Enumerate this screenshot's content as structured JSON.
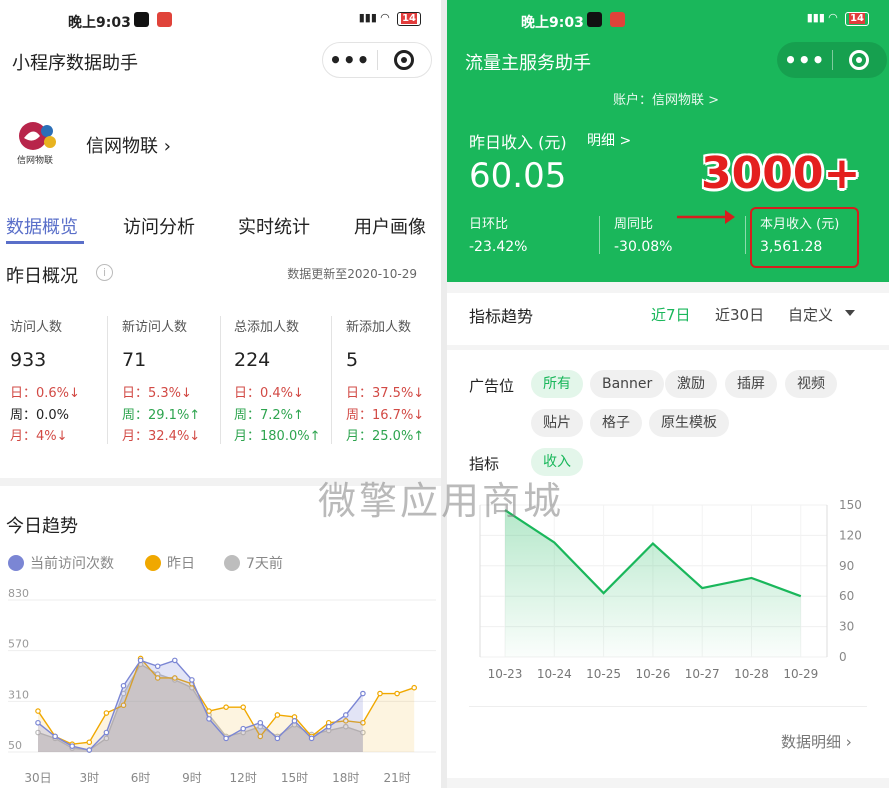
{
  "status": {
    "time": "晚上9:03",
    "battery": "14"
  },
  "left": {
    "title": "小程序数据助手",
    "account": "信网物联",
    "logo_text": "信网物联",
    "tabs": [
      "数据概览",
      "访问分析",
      "实时统计",
      "用户画像"
    ],
    "yday": {
      "title": "昨日概况",
      "updated": "数据更新至2020-10-29",
      "kpis": [
        {
          "label": "访问人数",
          "value": "933",
          "rows": [
            {
              "t": "日：0.6%↓",
              "c": "red"
            },
            {
              "t": "周：0.0%",
              "c": ""
            },
            {
              "t": "月：4%↓",
              "c": "red"
            }
          ]
        },
        {
          "label": "新访问人数",
          "value": "71",
          "rows": [
            {
              "t": "日：5.3%↓",
              "c": "red"
            },
            {
              "t": "周：29.1%↑",
              "c": "green"
            },
            {
              "t": "月：32.4%↓",
              "c": "red"
            }
          ]
        },
        {
          "label": "总添加人数",
          "value": "224",
          "rows": [
            {
              "t": "日：0.4%↓",
              "c": "red"
            },
            {
              "t": "周：7.2%↑",
              "c": "green"
            },
            {
              "t": "月：180.0%↑",
              "c": "green"
            }
          ]
        },
        {
          "label": "新添加人数",
          "value": "5",
          "rows": [
            {
              "t": "日：37.5%↓",
              "c": "red"
            },
            {
              "t": "周：16.7%↓",
              "c": "red"
            },
            {
              "t": "月：25.0%↑",
              "c": "green"
            }
          ]
        }
      ]
    },
    "trend_title": "今日趋势",
    "legend": [
      {
        "name": "当前访问次数",
        "color": "#7b86d4"
      },
      {
        "name": "昨日",
        "color": "#f0a800"
      },
      {
        "name": "7天前",
        "color": "#bdbdbd"
      }
    ]
  },
  "right": {
    "title": "流量主服务助手",
    "account": "账户：信网物联 >",
    "income_label": "昨日收入 (元)",
    "detail": "明细 >",
    "income_value": "60.05",
    "annotation": "3000+",
    "stats": [
      {
        "label": "日环比",
        "value": "-23.42%"
      },
      {
        "label": "周同比",
        "value": "-30.08%"
      },
      {
        "label": "本月收入 (元)",
        "value": "3,561.28"
      }
    ],
    "indicator_title": "指标趋势",
    "ranges": [
      "近7日",
      "近30日",
      "自定义"
    ],
    "ad_label": "广告位",
    "ad_chips": [
      "所有",
      "Banner",
      "激励",
      "插屏",
      "视频",
      "贴片",
      "格子",
      "原生模板"
    ],
    "metric_label": "指标",
    "metric_chip": "收入",
    "more": "数据明细"
  },
  "watermark": "微擎应用商城",
  "chart_data": [
    {
      "type": "area",
      "x": [
        "30日",
        "1时",
        "2时",
        "3时",
        "4时",
        "5时",
        "6时",
        "7时",
        "8时",
        "9时",
        "10时",
        "11时",
        "12时",
        "13时",
        "14时",
        "15时",
        "16时",
        "17时",
        "18时",
        "19时",
        "20时",
        "21时",
        "22时",
        "23时"
      ],
      "x_tick_labels": [
        "30日",
        "3时",
        "6时",
        "9时",
        "12时",
        "15时",
        "18时",
        "21时"
      ],
      "y_ticks": [
        50,
        310,
        570,
        830
      ],
      "ylim": [
        50,
        830
      ],
      "series": [
        {
          "name": "当前访问次数",
          "values": [
            200,
            130,
            80,
            60,
            150,
            390,
            520,
            490,
            520,
            420,
            220,
            120,
            170,
            200,
            120,
            210,
            120,
            180,
            240,
            350
          ]
        },
        {
          "name": "昨日",
          "values": [
            260,
            130,
            90,
            100,
            250,
            290,
            530,
            430,
            430,
            400,
            260,
            280,
            280,
            130,
            240,
            230,
            130,
            200,
            210,
            200,
            350,
            350,
            380
          ]
        },
        {
          "name": "7天前",
          "values": [
            150,
            120,
            70,
            60,
            120,
            350,
            500,
            450,
            420,
            380,
            240,
            130,
            150,
            180,
            130,
            190,
            140,
            160,
            180,
            150
          ]
        }
      ]
    },
    {
      "type": "area",
      "x": [
        "10-23",
        "10-24",
        "10-25",
        "10-26",
        "10-27",
        "10-28",
        "10-29"
      ],
      "values": [
        145,
        113,
        63,
        112,
        68,
        78,
        60
      ],
      "y_ticks": [
        0,
        30,
        60,
        90,
        120,
        150
      ],
      "ylim": [
        0,
        150
      ]
    }
  ]
}
